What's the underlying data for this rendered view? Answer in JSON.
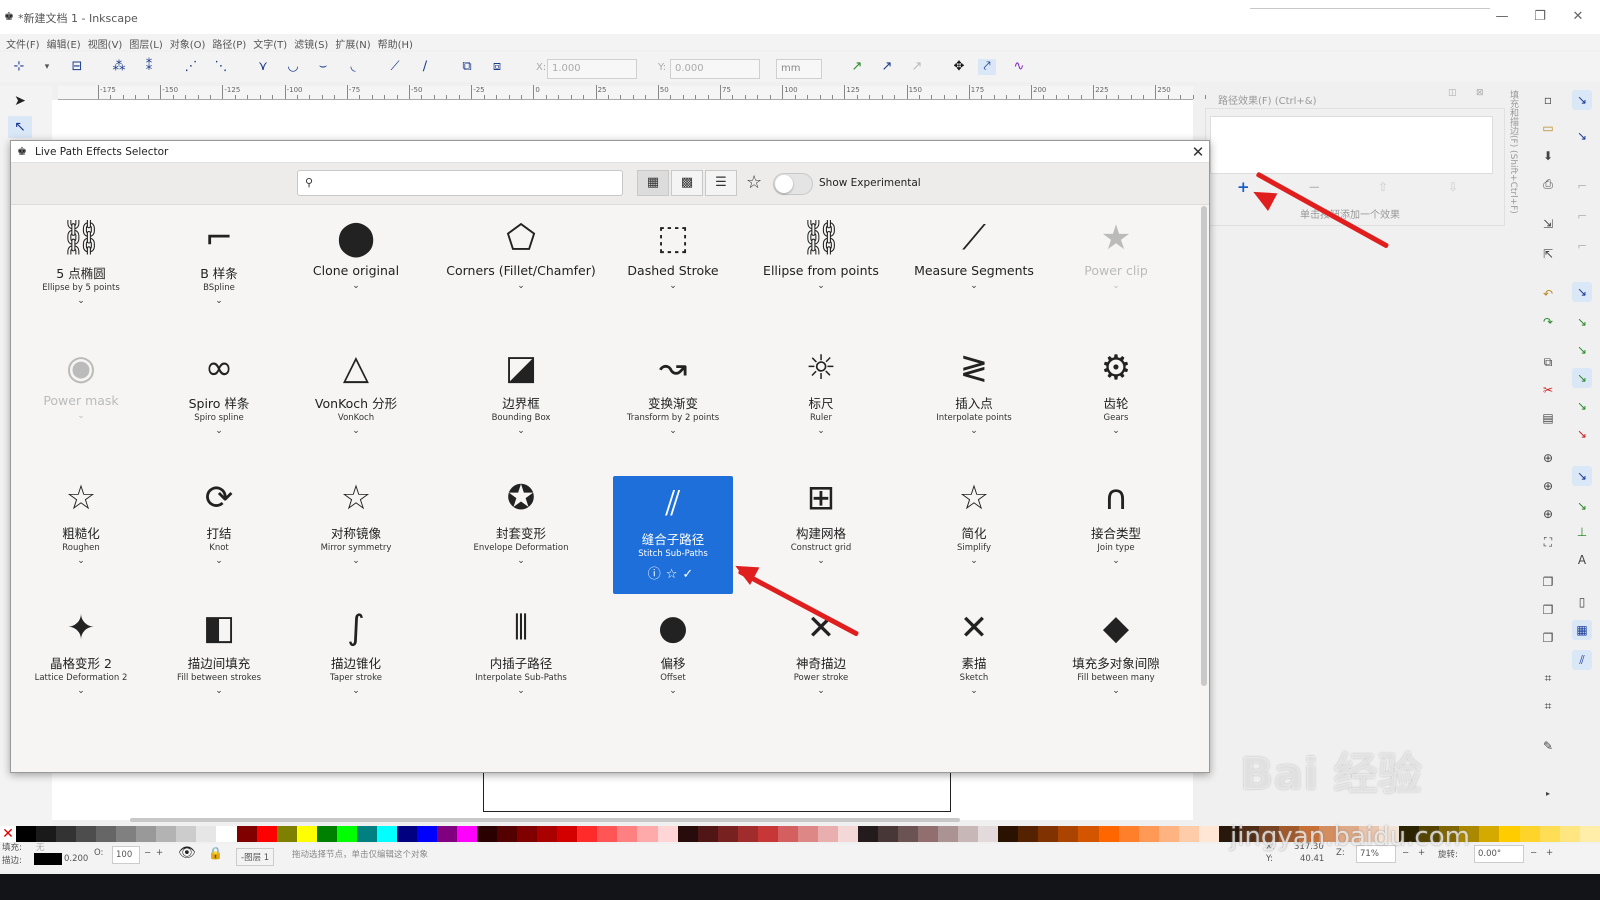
{
  "window": {
    "title": "*新建文档 1 - Inkscape",
    "minimize": "—",
    "maximize": "❐",
    "close": "✕"
  },
  "menu": [
    "文件(F)",
    "编辑(E)",
    "视图(V)",
    "图层(L)",
    "对象(O)",
    "路径(P)",
    "文字(T)",
    "滤镜(S)",
    "扩展(N)",
    "帮助(H)"
  ],
  "toolbar": {
    "x_label": "X:",
    "x_value": "1.000",
    "y_label": "Y:",
    "y_value": "0.000",
    "unit": "mm"
  },
  "ruler_labels": [
    "-175",
    "-150",
    "-125",
    "-100",
    "-75",
    "-50",
    "-25",
    "0",
    "25",
    "50",
    "75",
    "100",
    "125",
    "150",
    "175",
    "200",
    "225",
    "250"
  ],
  "lpe_panel": {
    "title": "路径效果(F) (Ctrl+&)",
    "add": "+",
    "remove": "−",
    "hint": "单击按钮添加一个效果",
    "vertical_tab": "填充和描边(F) (Shift+Ctrl+F)"
  },
  "dialog": {
    "title": "Live Path Effects Selector",
    "search_placeholder": "",
    "show_experimental": "Show Experimental",
    "close": "✕"
  },
  "effects": [
    {
      "icon": "⛓",
      "name": "5 点椭圆",
      "sub": "Ellipse by 5 points"
    },
    {
      "icon": "⌐",
      "name": "B 样条",
      "sub": "BSpline"
    },
    {
      "icon": "⬤",
      "name": "Clone original",
      "sub": ""
    },
    {
      "icon": "⬠",
      "name": "Corners (Fillet/Chamfer)",
      "sub": ""
    },
    {
      "icon": "⬚",
      "name": "Dashed Stroke",
      "sub": ""
    },
    {
      "icon": "⛓",
      "name": "Ellipse from points",
      "sub": ""
    },
    {
      "icon": "⟋",
      "name": "Measure Segments",
      "sub": ""
    },
    {
      "icon": "★",
      "name": "Power clip",
      "sub": "",
      "disabled": true
    },
    {
      "icon": "◉",
      "name": "Power mask",
      "sub": "",
      "disabled": true
    },
    {
      "icon": "∞",
      "name": "Spiro 样条",
      "sub": "Spiro spline"
    },
    {
      "icon": "△",
      "name": "VonKoch 分形",
      "sub": "VonKoch"
    },
    {
      "icon": "◪",
      "name": "边界框",
      "sub": "Bounding Box"
    },
    {
      "icon": "↝",
      "name": "变换渐变",
      "sub": "Transform by 2 points"
    },
    {
      "icon": "☼",
      "name": "标尺",
      "sub": "Ruler"
    },
    {
      "icon": "≷",
      "name": "插入点",
      "sub": "Interpolate points"
    },
    {
      "icon": "⚙",
      "name": "齿轮",
      "sub": "Gears"
    },
    {
      "icon": "☆",
      "name": "粗糙化",
      "sub": "Roughen"
    },
    {
      "icon": "⟳",
      "name": "打结",
      "sub": "Knot"
    },
    {
      "icon": "☆",
      "name": "对称镜像",
      "sub": "Mirror symmetry"
    },
    {
      "icon": "✪",
      "name": "封套变形",
      "sub": "Envelope Deformation"
    },
    {
      "icon": "⫽",
      "name": "缝合子路径",
      "sub": "Stitch Sub-Paths",
      "selected": true
    },
    {
      "icon": "⊞",
      "name": "构建网格",
      "sub": "Construct grid"
    },
    {
      "icon": "☆",
      "name": "简化",
      "sub": "Simplify"
    },
    {
      "icon": "∩",
      "name": "接合类型",
      "sub": "Join type"
    },
    {
      "icon": "✦",
      "name": "晶格变形 2",
      "sub": "Lattice Deformation 2"
    },
    {
      "icon": "◧",
      "name": "描边间填充",
      "sub": "Fill between strokes"
    },
    {
      "icon": "∫",
      "name": "描边锥化",
      "sub": "Taper stroke"
    },
    {
      "icon": "⦀",
      "name": "内插子路径",
      "sub": "Interpolate Sub-Paths"
    },
    {
      "icon": "●",
      "name": "偏移",
      "sub": "Offset"
    },
    {
      "icon": "✕",
      "name": "神奇描边",
      "sub": "Power stroke"
    },
    {
      "icon": "✕",
      "name": "素描",
      "sub": "Sketch"
    },
    {
      "icon": "◆",
      "name": "填充多对象间隙",
      "sub": "Fill between many"
    }
  ],
  "selected_actions": "ⓘ☆✓",
  "statusbar": {
    "fill_label": "填充:",
    "fill_value": "无",
    "stroke_label": "描边:",
    "stroke_width": "0.200",
    "opacity_label": "O:",
    "opacity_value": "100",
    "layer": "-图层 1",
    "message": "拖动选择节点，单击仅编辑这个对象",
    "x_label": "X:",
    "x_value": "317.30",
    "y_label": "Y:",
    "y_value": "40.41",
    "zoom_label": "Z:",
    "zoom_value": "71%",
    "rotate_label": "旋转:",
    "rotate_value": "0.00°"
  },
  "watermark": {
    "brand": "Bai 经验",
    "url": "jingyan.baidu.com"
  },
  "colors": {
    "accent": "#1e6fd9",
    "arrow": "#e01e1e"
  },
  "palette": [
    "#000000",
    "#1a1a1a",
    "#333333",
    "#4d4d4d",
    "#666666",
    "#808080",
    "#999999",
    "#b3b3b3",
    "#cccccc",
    "#e6e6e6",
    "#ffffff",
    "#800000",
    "#ff0000",
    "#808000",
    "#ffff00",
    "#008000",
    "#00ff00",
    "#008080",
    "#00ffff",
    "#000080",
    "#0000ff",
    "#800080",
    "#ff00ff",
    "#2b0000",
    "#550000",
    "#800000",
    "#aa0000",
    "#d40000",
    "#ff2a2a",
    "#ff5555",
    "#ff8080",
    "#ffaaaa",
    "#ffd5d5",
    "#280b0b",
    "#501616",
    "#782121",
    "#a02c2c",
    "#c83737",
    "#d35f5f",
    "#de8787",
    "#e9afaf",
    "#f4d7d7",
    "#241c1c",
    "#483737",
    "#6c5353",
    "#916f6f",
    "#ac9393",
    "#c8b7b7",
    "#e3dbdb",
    "#2b1100",
    "#552200",
    "#803300",
    "#aa4400",
    "#d45500",
    "#ff6600",
    "#ff7f2a",
    "#ff9955",
    "#ffb380",
    "#ffccaa",
    "#ffe6d5",
    "#28170b",
    "#502d16",
    "#784421",
    "#a05a2c",
    "#c87137",
    "#d38d5f",
    "#deaa87",
    "#e9c6af",
    "#f4e3d7",
    "#2b2200",
    "#554400",
    "#806600",
    "#aa8800",
    "#d4aa00",
    "#ffcc00",
    "#ffd42a",
    "#ffdd55",
    "#ffe680",
    "#ffeeaa"
  ]
}
